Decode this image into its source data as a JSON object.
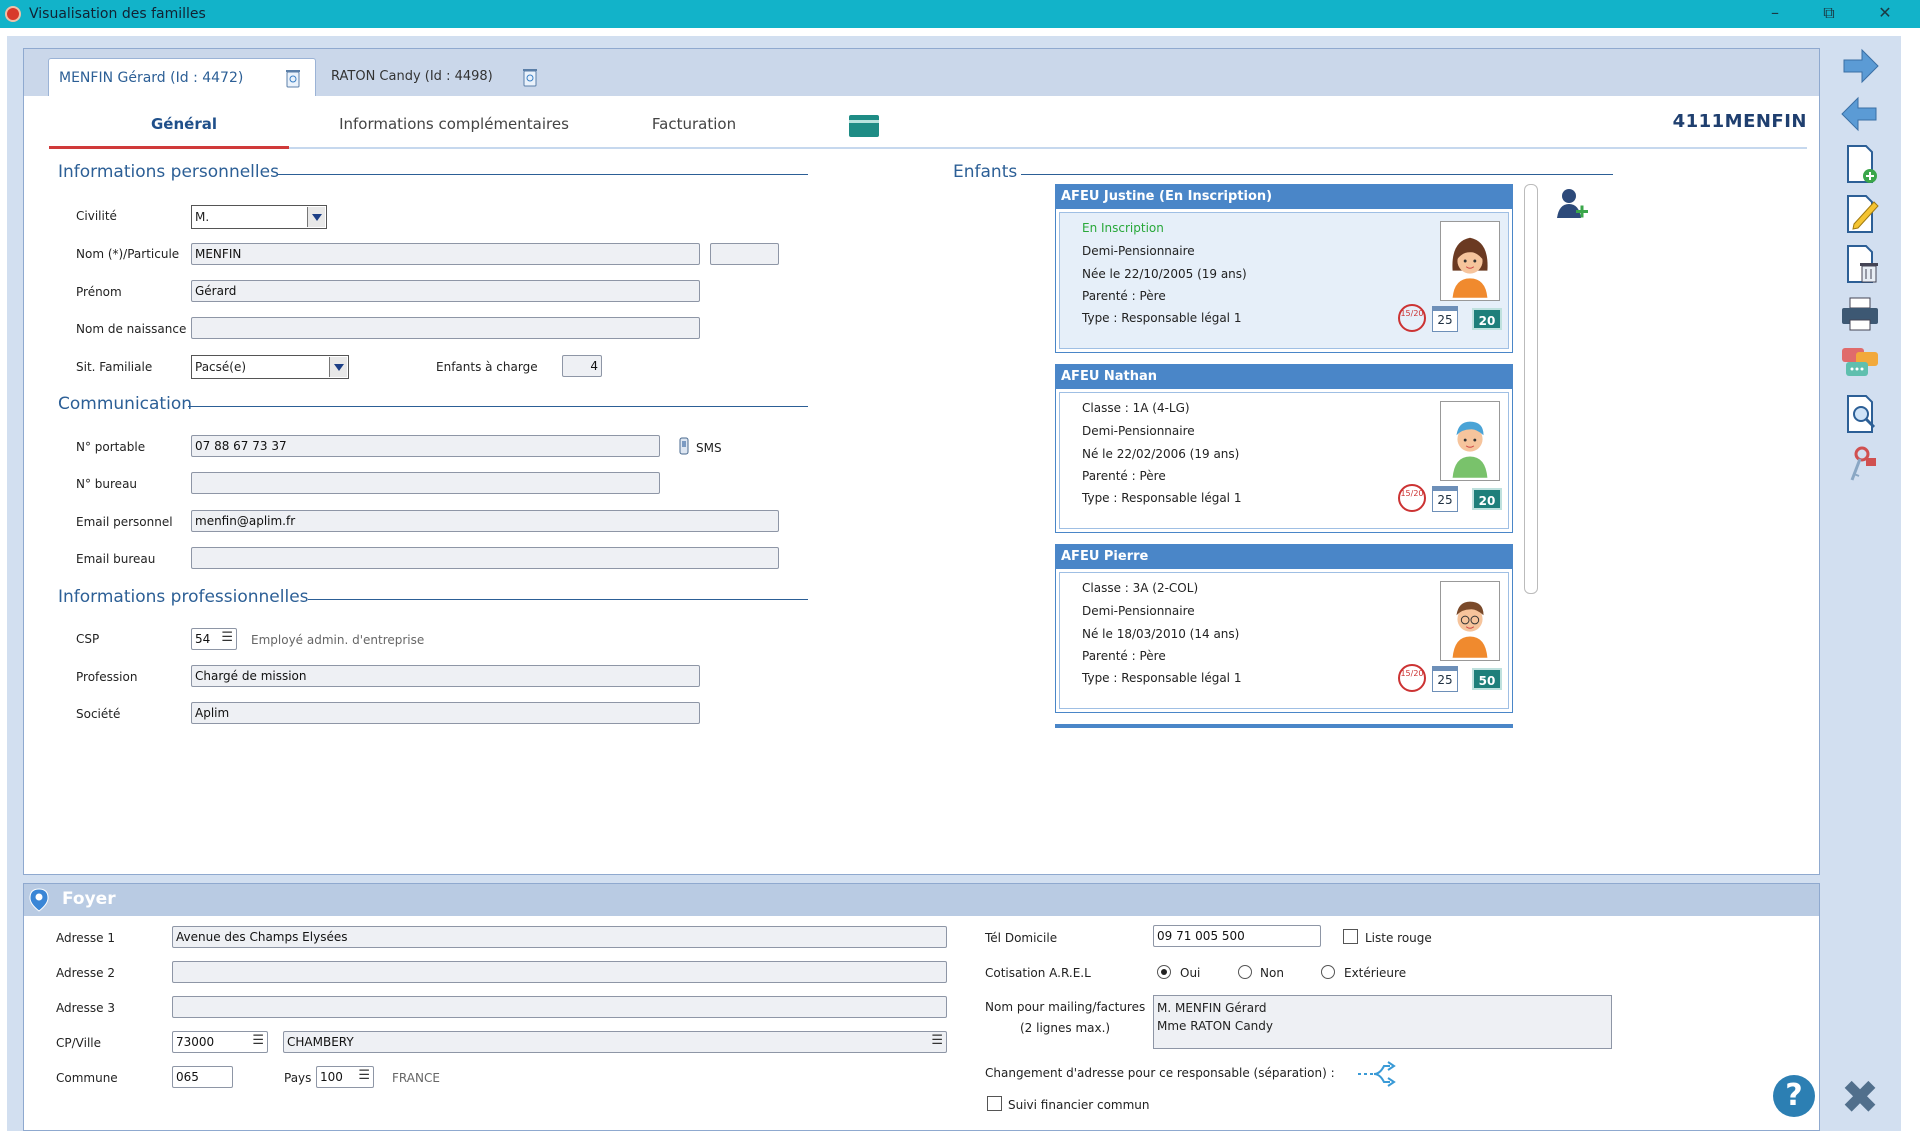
{
  "window": {
    "title": "Visualisation des familles",
    "restore_glyph": "⧉",
    "close_glyph": "✕"
  },
  "persons_tabs": [
    {
      "label": "MENFIN Gérard (Id : 4472)"
    },
    {
      "label": "RATON Candy (Id : 4498)"
    }
  ],
  "sub_tabs": {
    "general": "Général",
    "infos": "Informations complémentaires",
    "billing": "Facturation"
  },
  "account_code": "4111MENFIN",
  "personal": {
    "section": "Informations personnelles",
    "civility_label": "Civilité",
    "civility_value": "M.",
    "name_label": "Nom (*)/Particule",
    "name_value": "MENFIN",
    "particle_value": "",
    "firstname_label": "Prénom",
    "firstname_value": "Gérard",
    "birthname_label": "Nom de naissance",
    "birthname_value": "",
    "family_label": "Sit. Familiale",
    "family_value": "Pacsé(e)",
    "children_label": "Enfants à charge",
    "children_value": "4"
  },
  "communication": {
    "section": "Communication",
    "mobile_label": "N° portable",
    "mobile_value": "07 88 67 73 37",
    "sms_label": "SMS",
    "office_label": "N° bureau",
    "office_value": "",
    "email_label": "Email personnel",
    "email_value": "menfin@aplim.fr",
    "email_office_label": "Email bureau",
    "email_office_value": ""
  },
  "professional": {
    "section": "Informations professionnelles",
    "csp_label": "CSP",
    "csp_value": "54",
    "csp_hint": "Employé admin. d'entreprise",
    "profession_label": "Profession",
    "profession_value": "Chargé de mission",
    "company_label": "Société",
    "company_value": "Aplim"
  },
  "children": {
    "section": "Enfants",
    "items": [
      {
        "header": "AFEU Justine (En Inscription)",
        "l1": "En Inscription",
        "l2": "Demi-Pensionnaire",
        "l3": "Née le 22/10/2005 (19 ans)",
        "l4": "Parenté : Père",
        "l5": "Type : Responsable légal 1",
        "eval": "15/20",
        "cal": "25",
        "num": "20"
      },
      {
        "header": "AFEU Nathan",
        "l1": "Classe : 1A (4-LG)",
        "l2": "Demi-Pensionnaire",
        "l3": "Né le 22/02/2006 (19 ans)",
        "l4": "Parenté : Père",
        "l5": "Type : Responsable légal 1",
        "eval": "15/20",
        "cal": "25",
        "num": "20"
      },
      {
        "header": "AFEU Pierre",
        "l1": "Classe : 3A (2-COL)",
        "l2": "Demi-Pensionnaire",
        "l3": "Né le 18/03/2010 (14 ans)",
        "l4": "Parenté : Père",
        "l5": "Type : Responsable légal 1",
        "eval": "15/20",
        "cal": "25",
        "num": "50"
      }
    ]
  },
  "foyer": {
    "title": "Foyer",
    "addr1_label": "Adresse 1",
    "addr1_value": "Avenue des Champs Elysées",
    "addr2_label": "Adresse 2",
    "addr2_value": "",
    "addr3_label": "Adresse 3",
    "addr3_value": "",
    "cp_label": "CP/Ville",
    "cp_value": "73000",
    "city_value": "CHAMBERY",
    "commune_label": "Commune",
    "commune_value": "065",
    "country_label": "Pays",
    "country_value": "100",
    "country_name": "FRANCE",
    "tel_label": "Tél Domicile",
    "tel_value": "09 71 005 500",
    "redlist_label": "Liste rouge",
    "arel_label": "Cotisation A.R.E.L",
    "arel_yes": "Oui",
    "arel_no": "Non",
    "arel_ext": "Extérieure",
    "mailing_label1": "Nom pour mailing/factures",
    "mailing_label2": "(2 lignes max.)",
    "mailing_line1": "M. MENFIN Gérard",
    "mailing_line2": "Mme RATON Candy",
    "change_label": "Changement d'adresse pour ce responsable (séparation) :",
    "financial_label": "Suivi financier commun"
  },
  "colors": {
    "titlebar": "#12b3c9",
    "accent": "#2c5f96",
    "child_header": "#4a86c8",
    "status_green": "#29a83a",
    "badge_teal": "#1e7f7a"
  },
  "sidebar_icons": [
    "arrow-right-icon",
    "arrow-left-icon",
    "add-document-icon",
    "edit-document-icon",
    "delete-document-icon",
    "print-icon",
    "messages-icon",
    "search-document-icon",
    "keys-icon"
  ]
}
